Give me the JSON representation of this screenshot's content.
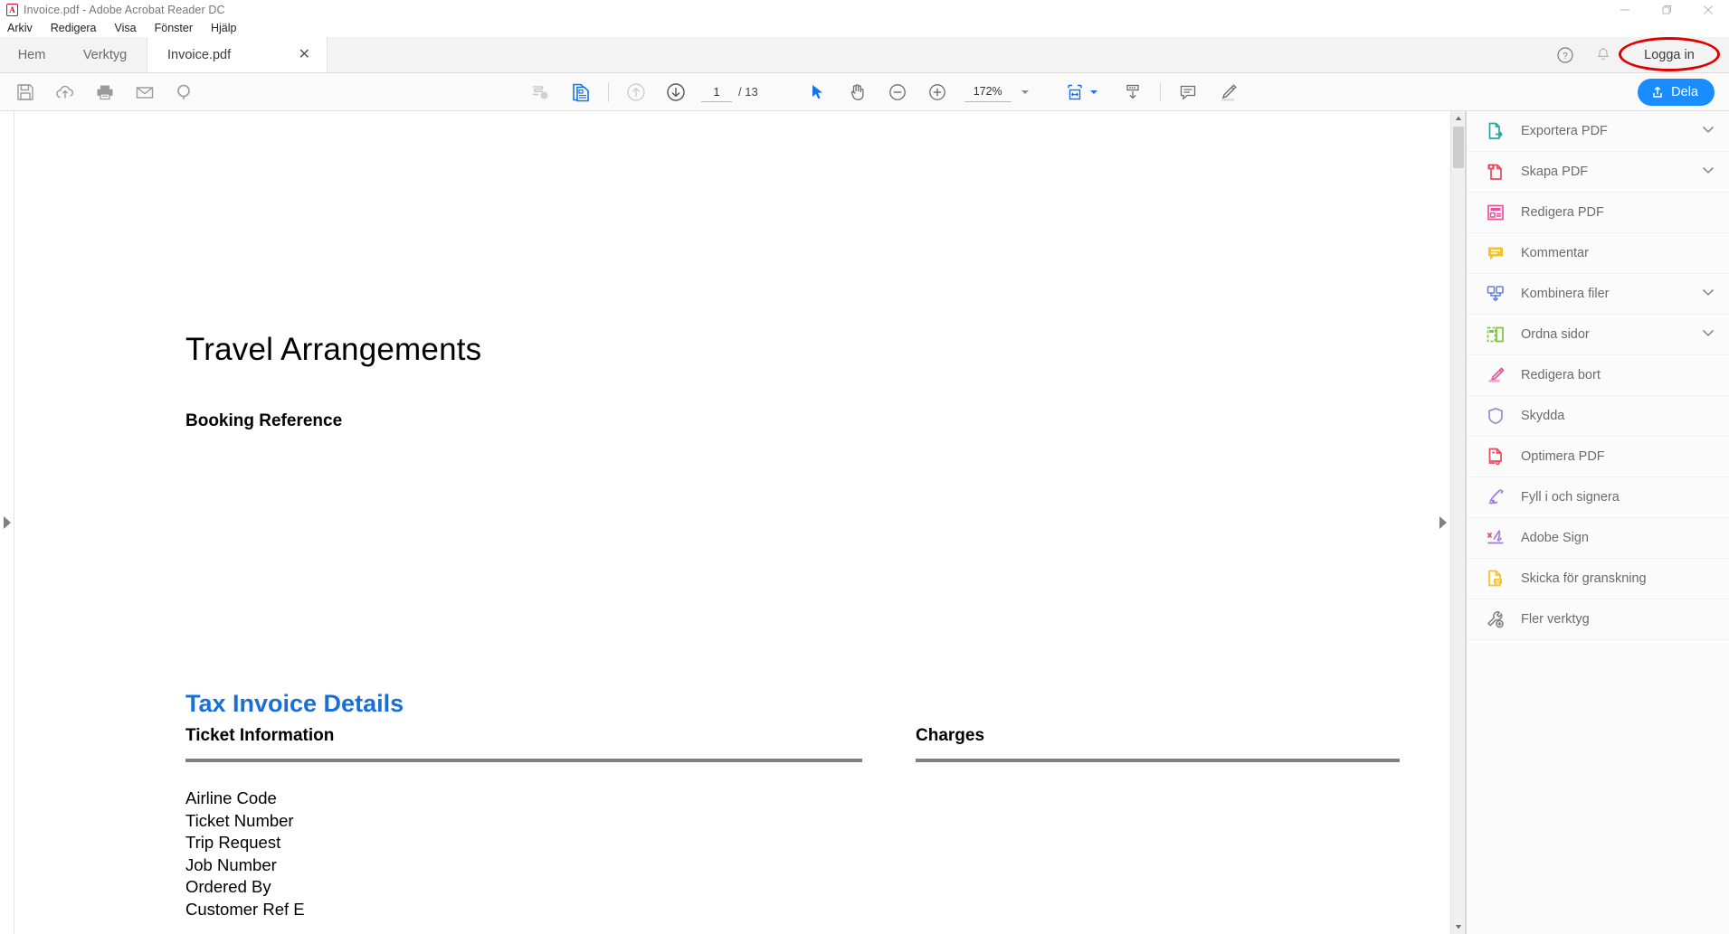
{
  "window": {
    "title": "Invoice.pdf - Adobe Acrobat Reader DC",
    "app_icon": "acrobat-icon",
    "minimize": "minimize-icon",
    "maximize": "maximize-icon",
    "close": "close-icon"
  },
  "menubar": {
    "items": [
      {
        "label": "Arkiv"
      },
      {
        "label": "Redigera"
      },
      {
        "label": "Visa"
      },
      {
        "label": "Fönster"
      },
      {
        "label": "Hjälp"
      }
    ]
  },
  "tabbar": {
    "home": "Hem",
    "tools": "Verktyg",
    "document_tab": "Invoice.pdf",
    "close_tab": "✕",
    "help_icon": "help-circle-icon",
    "bell_icon": "bell-icon",
    "sign_in": "Logga in",
    "highlight_color": "#e00000"
  },
  "toolbar": {
    "save_icon": "save-floppy-icon",
    "cloud_icon": "cloud-upload-icon",
    "print_icon": "print-icon",
    "email_icon": "email-icon",
    "search_icon": "search-icon",
    "sign_tool_icon": "signature-icon",
    "copy_page_icon": "page-thumbnail-icon",
    "prev_page_icon": "arrow-up-circle-icon",
    "next_page_icon": "arrow-down-circle-icon",
    "page_number": "1",
    "page_total": "/ 13",
    "select_tool_icon": "cursor-arrow-icon",
    "hand_tool_icon": "hand-icon",
    "zoom_out_icon": "zoom-out-icon",
    "zoom_in_icon": "zoom-in-icon",
    "zoom_level": "172%",
    "zoom_caret_icon": "chevron-down-icon",
    "fit_page_icon": "fit-page-icon",
    "fit_caret_icon": "chevron-down-icon",
    "scroll_mode_icon": "scroll-mode-icon",
    "comment_icon": "comment-bubble-icon",
    "highlight_icon": "highlighter-icon",
    "share_icon": "share-upload-icon",
    "share_label": "Dela",
    "share_color": "#1a8cff",
    "accent_blue": "#1473e6"
  },
  "viewer": {
    "left_panel_toggle_icon": "triangle-right-icon",
    "right_panel_toggle_icon": "triangle-right-icon",
    "scroll_up_icon": "scroll-arrow-up-icon",
    "scroll_down_icon": "scroll-arrow-down-icon"
  },
  "document": {
    "title": "Travel Arrangements",
    "subtitle": "Booking Reference",
    "tax_heading": "Tax Invoice Details",
    "tax_heading_color": "#1a6fd4",
    "ticket_information": "Ticket Information",
    "charges": "Charges",
    "fields": [
      "Airline Code",
      "Ticket Number",
      "Trip Request",
      "Job Number",
      "Ordered By",
      "Customer Ref E"
    ]
  },
  "tools_panel": {
    "items": [
      {
        "label": "Exportera PDF",
        "icon": "export-pdf-icon",
        "color": "#2ba6a0",
        "chevron": true
      },
      {
        "label": "Skapa PDF",
        "icon": "create-pdf-icon",
        "color": "#e8495a",
        "chevron": true
      },
      {
        "label": "Redigera PDF",
        "icon": "edit-pdf-icon",
        "color": "#e8509b",
        "chevron": false
      },
      {
        "label": "Kommentar",
        "icon": "comment-icon",
        "color": "#f5c325",
        "chevron": false
      },
      {
        "label": "Kombinera filer",
        "icon": "combine-files-icon",
        "color": "#6a82d8",
        "chevron": true
      },
      {
        "label": "Ordna sidor",
        "icon": "organize-pages-icon",
        "color": "#7dc242",
        "chevron": true
      },
      {
        "label": "Redigera bort",
        "icon": "redact-icon",
        "color": "#e8509b",
        "chevron": false
      },
      {
        "label": "Skydda",
        "icon": "shield-icon",
        "color": "#8f8fd4",
        "chevron": false
      },
      {
        "label": "Optimera PDF",
        "icon": "optimize-pdf-icon",
        "color": "#e8495a",
        "chevron": false
      },
      {
        "label": "Fyll i och signera",
        "icon": "fill-and-sign-icon",
        "color": "#9f7ae0",
        "chevron": false
      },
      {
        "label": "Adobe Sign",
        "icon": "adobe-sign-icon",
        "color": "#9f7ae0",
        "chevron": false
      },
      {
        "label": "Skicka för granskning",
        "icon": "send-for-review-icon",
        "color": "#f5c325",
        "chevron": false
      },
      {
        "label": "Fler verktyg",
        "icon": "more-tools-icon",
        "color": "#808080",
        "chevron": false
      }
    ]
  }
}
